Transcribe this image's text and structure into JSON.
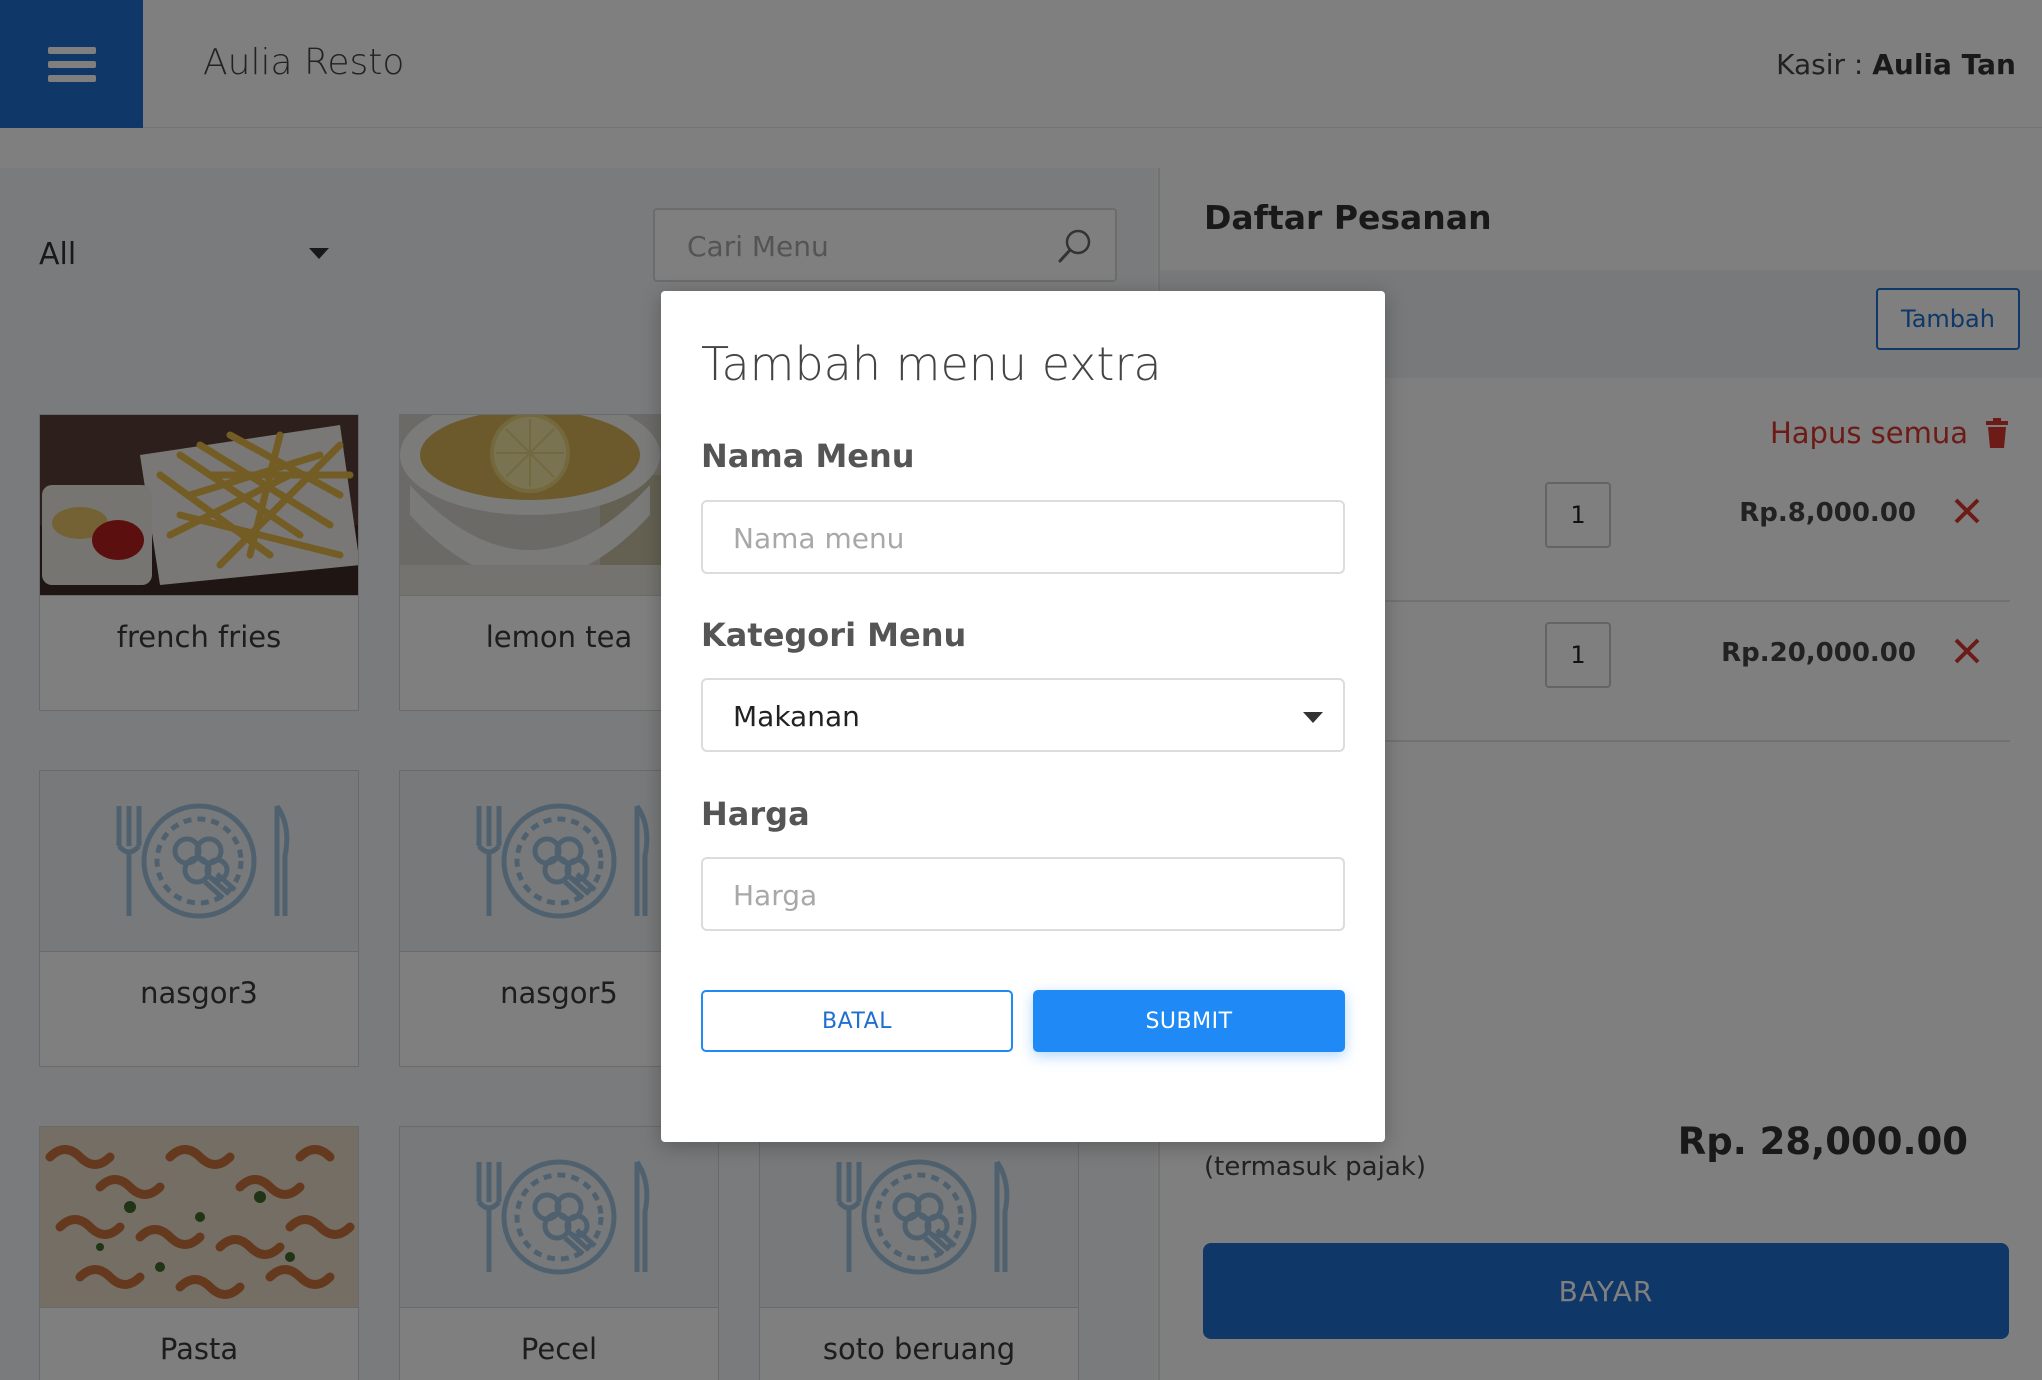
{
  "header": {
    "app_title": "Aulia Resto",
    "cashier_label": "Kasir : ",
    "cashier_name": "Aulia Tan"
  },
  "menu_panel": {
    "category_selected": "All",
    "search_placeholder": "Cari Menu",
    "items": [
      {
        "name": "french fries",
        "image": "photo"
      },
      {
        "name": "lemon tea",
        "image": "photo"
      },
      {
        "name": "nasgor3",
        "image": "plate-cutlery-icon"
      },
      {
        "name": "nasgor5",
        "image": "plate-cutlery-icon"
      },
      {
        "name": "Pasta",
        "image": "photo"
      },
      {
        "name": "Pecel",
        "image": "plate-cutlery-icon"
      },
      {
        "name": "soto beruang",
        "image": "plate-cutlery-icon"
      }
    ]
  },
  "order_panel": {
    "title": "Daftar Pesanan",
    "add_button": "Tambah",
    "clear_all": "Hapus semua",
    "rows": [
      {
        "qty": "1",
        "price": "Rp.8,000.00"
      },
      {
        "qty": "1",
        "price": "Rp.20,000.00"
      }
    ],
    "tax_note": "(termasuk pajak)",
    "total": "Rp. 28,000.00",
    "pay_button": "BAYAR"
  },
  "modal": {
    "title": "Tambah menu extra",
    "name_label": "Nama Menu",
    "name_placeholder": "Nama menu",
    "category_label": "Kategori Menu",
    "category_value": "Makanan",
    "price_label": "Harga",
    "price_placeholder": "Harga",
    "cancel_button": "BATAL",
    "submit_button": "SUBMIT"
  },
  "colors": {
    "primary": "#1f6fd1",
    "submit": "#1f8af5",
    "danger": "#d9362f",
    "overlay": "rgba(0,0,0,0.5)"
  }
}
